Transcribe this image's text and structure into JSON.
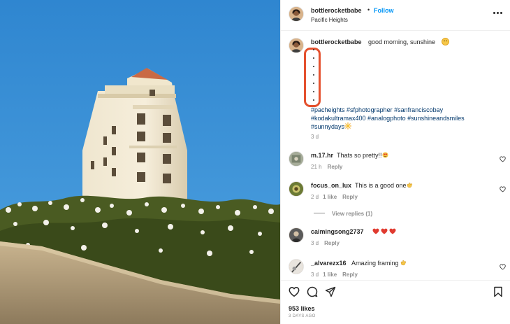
{
  "post": {
    "username": "bottlerocketbabe",
    "separator": "•",
    "follow_label": "Follow",
    "location": "Pacific Heights",
    "more_icon": "more-horizontal-icon"
  },
  "caption": {
    "username": "bottlerocketbabe",
    "text": "good morning, sunshine",
    "emoji": "smiling-face-emoji",
    "hashtags_line1": "#pacheights #sfphotographer #sanfranciscobay",
    "hashtags_line2": "#kodakultramax400 #analogphoto #sunshineandsmiles",
    "hashtags_line3": "#sunnydays",
    "hashtags_emoji": "sun-emoji",
    "time": "3 d",
    "annotation_color": "#e4512e"
  },
  "comments": [
    {
      "username": "m.17.hr",
      "text": "Thats so pretty!!",
      "emoji": "heart-eyes-emoji",
      "time": "21 h",
      "likes": "",
      "reply_label": "Reply"
    },
    {
      "username": "focus_on_lux",
      "text": "This is a good one",
      "emoji": "clapping-hands-emoji",
      "time": "2 d",
      "likes": "1 like",
      "reply_label": "Reply"
    },
    {
      "username": "caimingsong2737",
      "text": "",
      "emoji": "three-red-hearts-emoji",
      "time": "3 d",
      "likes": "",
      "reply_label": "Reply"
    },
    {
      "username": "_alvarezx16",
      "text": "Amazing framing",
      "emoji": "clapping-hands-emoji",
      "time": "3 d",
      "likes": "1 like",
      "reply_label": "Reply"
    }
  ],
  "view_replies_label": "View replies (1)",
  "actions": {
    "like_icon": "heart-icon",
    "comment_icon": "comment-icon",
    "share_icon": "send-icon",
    "save_icon": "bookmark-icon"
  },
  "likes_count": "953 likes",
  "posted_ago": "3 DAYS AGO",
  "colors": {
    "link_blue": "#0095f6",
    "hashtag_blue": "#00376b",
    "muted": "#8e8e8e",
    "text": "#262626"
  }
}
